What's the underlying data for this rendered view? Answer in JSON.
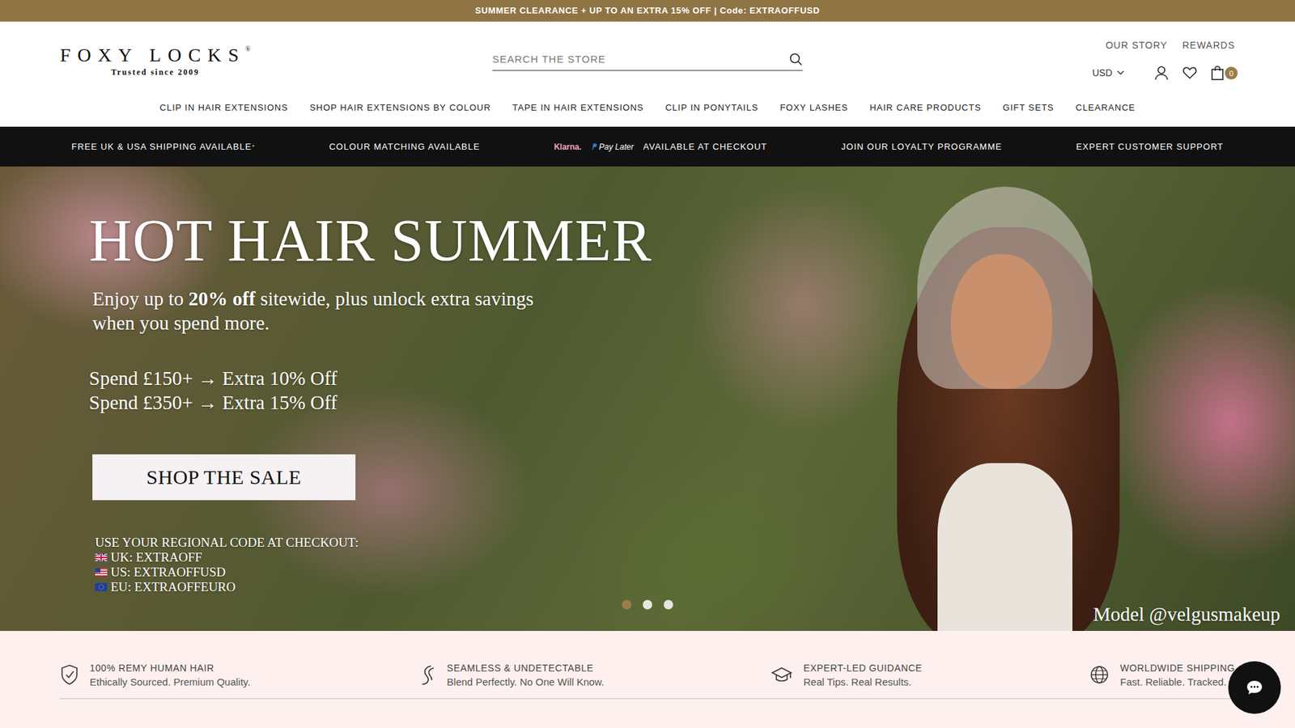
{
  "announcement": "SUMMER CLEARANCE + UP TO AN EXTRA 15% OFF | Code: EXTRAOFFUSD",
  "logo": {
    "name": "FOXY LOCKS",
    "mark": "®",
    "tagline": "Trusted since 2009"
  },
  "search": {
    "placeholder": "SEARCH THE STORE"
  },
  "top_links": [
    "OUR STORY",
    "REWARDS"
  ],
  "currency": "USD",
  "cart_count": "0",
  "nav": [
    "CLIP IN HAIR EXTENSIONS",
    "SHOP HAIR EXTENSIONS BY COLOUR",
    "TAPE IN HAIR EXTENSIONS",
    "CLIP IN PONYTAILS",
    "FOXY LASHES",
    "HAIR CARE PRODUCTS",
    "GIFT SETS",
    "CLEARANCE"
  ],
  "usp_bar": [
    {
      "label": "FREE UK & USA SHIPPING AVAILABLE",
      "sup": "*",
      "logos": []
    },
    {
      "label": "COLOUR MATCHING AVAILABLE",
      "sup": "",
      "logos": []
    },
    {
      "label": "AVAILABLE AT CHECKOUT",
      "sup": "",
      "logos": [
        "Klarna.",
        "Pay Later"
      ]
    },
    {
      "label": "JOIN OUR LOYALTY PROGRAMME",
      "sup": "",
      "logos": []
    },
    {
      "label": "EXPERT CUSTOMER SUPPORT",
      "sup": "",
      "logos": []
    }
  ],
  "hero": {
    "title": "HOT HAIR SUMMER",
    "subtitle": [
      {
        "text": "Enjoy up to ",
        "bold": false
      },
      {
        "text": "20% off",
        "bold": true
      },
      {
        "text": " sitewide, plus unlock extra savings when you spend more.",
        "bold": false
      }
    ],
    "tiers": [
      "Spend £150+ → Extra 10% Off",
      "Spend £350+ → Extra 15% Off"
    ],
    "button": "SHOP THE SALE",
    "codes_heading": "USE YOUR REGIONAL CODE AT CHECKOUT:",
    "codes": [
      {
        "kind": "uk",
        "label": "UK: EXTRAOFF"
      },
      {
        "kind": "us",
        "label": "US: EXTRAOFFUSD"
      },
      {
        "kind": "eu",
        "label": "EU: EXTRAOFFEURO"
      }
    ],
    "credit": "Model @velgusmakeup",
    "dots": [
      {
        "selected": true
      },
      {
        "selected": false
      },
      {
        "selected": false
      }
    ]
  },
  "features": [
    {
      "kind": "badge",
      "title": "100% REMY HUMAN HAIR",
      "subtitle": "Ethically Sourced. Premium Quality."
    },
    {
      "kind": "strand",
      "title": "SEAMLESS & UNDETECTABLE",
      "subtitle": "Blend Perfectly. No One Will Know."
    },
    {
      "kind": "cap",
      "title": "EXPERT-LED GUIDANCE",
      "subtitle": "Real Tips. Real Results."
    },
    {
      "kind": "globe",
      "title": "WORLDWIDE SHIPPING",
      "subtitle": "Fast. Reliable. Tracked."
    }
  ]
}
